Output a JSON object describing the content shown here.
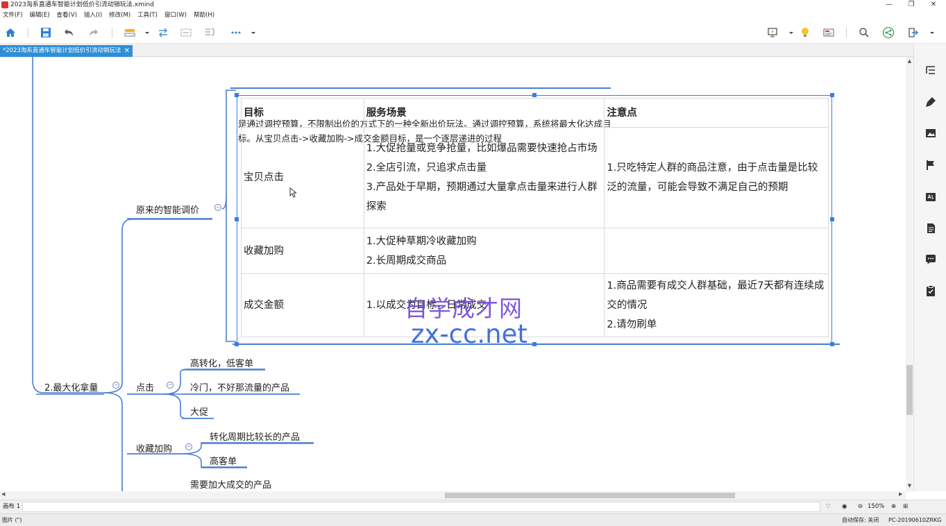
{
  "window": {
    "title": "2023淘系直通车智能计划低价引流动销玩法.xmind",
    "minimize": "—",
    "maximize": "❐",
    "close": "✕"
  },
  "menu": [
    "文件(F)",
    "编辑(E)",
    "查看(V)",
    "插入(I)",
    "修改(M)",
    "工具(T)",
    "窗口(W)",
    "帮助(H)"
  ],
  "tab": {
    "label": "*2023淘系直通车智能计划低价引流动销玩法",
    "close": "✕"
  },
  "note": "是通过调控预算，不限制出价的方式下的一种全新出价玩法。通过调控预算，系统将最大化达成目标。从宝贝点击->收藏加购->成交金额目标，是一个逐层递进的过程",
  "table": {
    "headers": [
      "目标",
      "服务场景",
      "注意点"
    ],
    "rows": [
      {
        "goal": "宝贝点击",
        "scenes": [
          "1.大促抢量或竞争抢量，比如爆品需要快速抢占市场",
          "2.全店引流，只追求点击量",
          "3.产品处于早期，预期通过大量拿点击量来进行人群探索"
        ],
        "notes": [
          "1.只吃特定人群的商品注意，由于点击量是比较泛的流量，可能会导致不满足自己的预期"
        ]
      },
      {
        "goal": "收藏加购",
        "scenes": [
          "1.大促种草期冷收藏加购",
          "2.长周期成交商品"
        ],
        "notes": []
      },
      {
        "goal": "成交金额",
        "scenes": [
          "1.以成交为目标，日常成交"
        ],
        "notes": [
          "1.商品需要有成交人群基础，最近7天都有连续成交的情况",
          "2.请勿刷单"
        ]
      }
    ]
  },
  "nodes": {
    "original": "原来的智能调价",
    "main": "2.最大化拿量",
    "click": "点击",
    "click_children": [
      "高转化，低客单",
      "冷门，不好那流量的产品",
      "大促"
    ],
    "fav": "收藏加购",
    "fav_children": [
      "转化周期比较长的产品",
      "高客单"
    ],
    "deal_hint": "需要加大成交的产品"
  },
  "watermark": {
    "line1": "自学成才网",
    "line2": "zx-cc.net"
  },
  "sheet": {
    "name": "画布 1",
    "zoom": "150%"
  },
  "status": {
    "left": "图片 (\")",
    "autosave": "自动保存: 关闭",
    "pc": "PC-20190610ZRKG"
  },
  "colors": {
    "accent": "#2f8fd6",
    "branch": "#4a7fd0",
    "selection": "#3d7ddb"
  }
}
